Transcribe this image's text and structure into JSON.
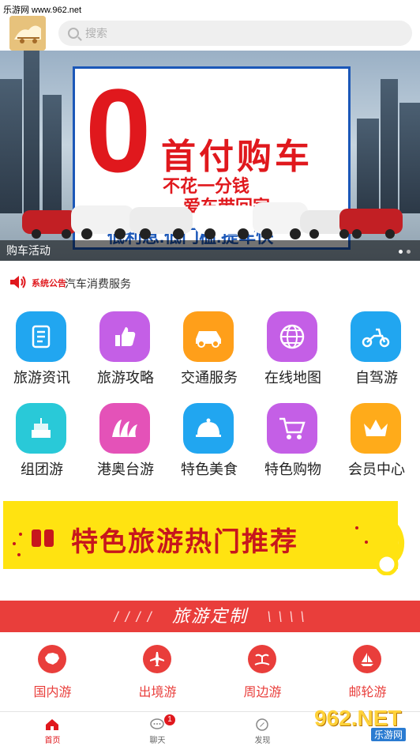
{
  "watermark_top": "乐游网 www.962.net",
  "search": {
    "placeholder": "搜索"
  },
  "banner": {
    "zero": "0",
    "headline": "首付购车",
    "line2": "不花一分钱",
    "line3": "爱车带回家",
    "line4": "低利息.低门槛.提车快",
    "caption": "购车活动",
    "dots_total": 2,
    "dots_active": 1
  },
  "notice": {
    "tag": "系统公告",
    "text": "汽车消费服务"
  },
  "grid": [
    {
      "label": "旅游资讯",
      "icon": "notebook-icon",
      "color": "#21a6f0"
    },
    {
      "label": "旅游攻略",
      "icon": "thumbs-up-icon",
      "color": "#c45fe6"
    },
    {
      "label": "交通服务",
      "icon": "car-icon",
      "color": "#ff9f1a"
    },
    {
      "label": "在线地图",
      "icon": "globe-icon",
      "color": "#c45fe6"
    },
    {
      "label": "自驾游",
      "icon": "scooter-icon",
      "color": "#21a6f0"
    },
    {
      "label": "组团游",
      "icon": "cake-icon",
      "color": "#29c9d8"
    },
    {
      "label": "港奥台游",
      "icon": "opera-house-icon",
      "color": "#e452b8"
    },
    {
      "label": "特色美食",
      "icon": "food-dome-icon",
      "color": "#21a6f0"
    },
    {
      "label": "特色购物",
      "icon": "shopping-cart-icon",
      "color": "#c45fe6"
    },
    {
      "label": "会员中心",
      "icon": "crown-icon",
      "color": "#ffab1a"
    }
  ],
  "promo": {
    "text": "特色旅游热门推荐"
  },
  "section": {
    "title": "旅游定制"
  },
  "categories": [
    {
      "label": "国内游",
      "icon": "china-map-icon"
    },
    {
      "label": "出境游",
      "icon": "airplane-icon"
    },
    {
      "label": "周边游",
      "icon": "island-icon"
    },
    {
      "label": "邮轮游",
      "icon": "sailboat-icon"
    }
  ],
  "tabbar": [
    {
      "label": "首页",
      "icon": "home-icon",
      "active": true
    },
    {
      "label": "聊天",
      "icon": "chat-icon",
      "active": false,
      "badge": "1"
    },
    {
      "label": "发现",
      "icon": "compass-icon",
      "active": false
    },
    {
      "label": "",
      "icon": "",
      "active": false
    }
  ],
  "watermark_bottom": {
    "logo": "962.NET",
    "sub": "乐游网"
  },
  "colors": {
    "accent_red": "#e93e3b",
    "promo_yellow": "#ffe311",
    "banner_blue": "#1b57b8"
  }
}
